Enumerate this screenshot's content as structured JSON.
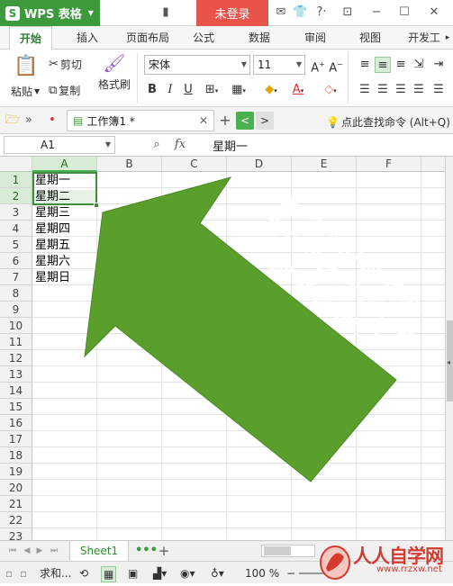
{
  "app": {
    "name": "WPS 表格",
    "logo_letter": "S",
    "login_label": "未登录"
  },
  "ribbon_tabs": [
    {
      "label": "开始",
      "active": true
    },
    {
      "label": "插入"
    },
    {
      "label": "页面布局"
    },
    {
      "label": "公式"
    },
    {
      "label": "数据"
    },
    {
      "label": "审阅"
    },
    {
      "label": "视图"
    },
    {
      "label": "开发工"
    }
  ],
  "ribbon": {
    "paste_label": "粘贴",
    "cut_label": "剪切",
    "copy_label": "复制",
    "format_painter_label": "格式刷",
    "font_name": "宋体",
    "font_size": "11",
    "bold": "B",
    "italic": "I",
    "underline": "U"
  },
  "document": {
    "tab_title": "工作簿1 *",
    "search_command_label": "点此查找命令 (Alt+Q)"
  },
  "formula_bar": {
    "cell_ref": "A1",
    "fx_label": "fx",
    "content": "星期一"
  },
  "grid": {
    "columns": [
      "A",
      "B",
      "C",
      "D",
      "E",
      "F"
    ],
    "rows": [
      "1",
      "2",
      "3",
      "4",
      "5",
      "6",
      "7",
      "8",
      "9",
      "10",
      "11",
      "12",
      "13",
      "14",
      "15",
      "16",
      "17",
      "18",
      "19",
      "20",
      "21",
      "22",
      "23"
    ],
    "column_a_values": [
      "星期一",
      "星期二",
      "星期三",
      "星期四",
      "星期五",
      "星期六",
      "星期日"
    ]
  },
  "annotation": {
    "line1": "输入两个格子的内容后，",
    "line2": "向下一拖这个小方块，其",
    "line3": "余的就自动搞定了",
    "arrow_color": "#5a9e2c"
  },
  "sheets": {
    "active": "Sheet1",
    "more": "•••",
    "add": "+"
  },
  "status": {
    "sum_label": "求和...",
    "zoom": "100 %"
  },
  "watermark": {
    "text": "人人自学网",
    "url": "www.rrzxw.net"
  },
  "colors": {
    "accent": "#3c9a3c",
    "login_bg": "#e8544a"
  }
}
